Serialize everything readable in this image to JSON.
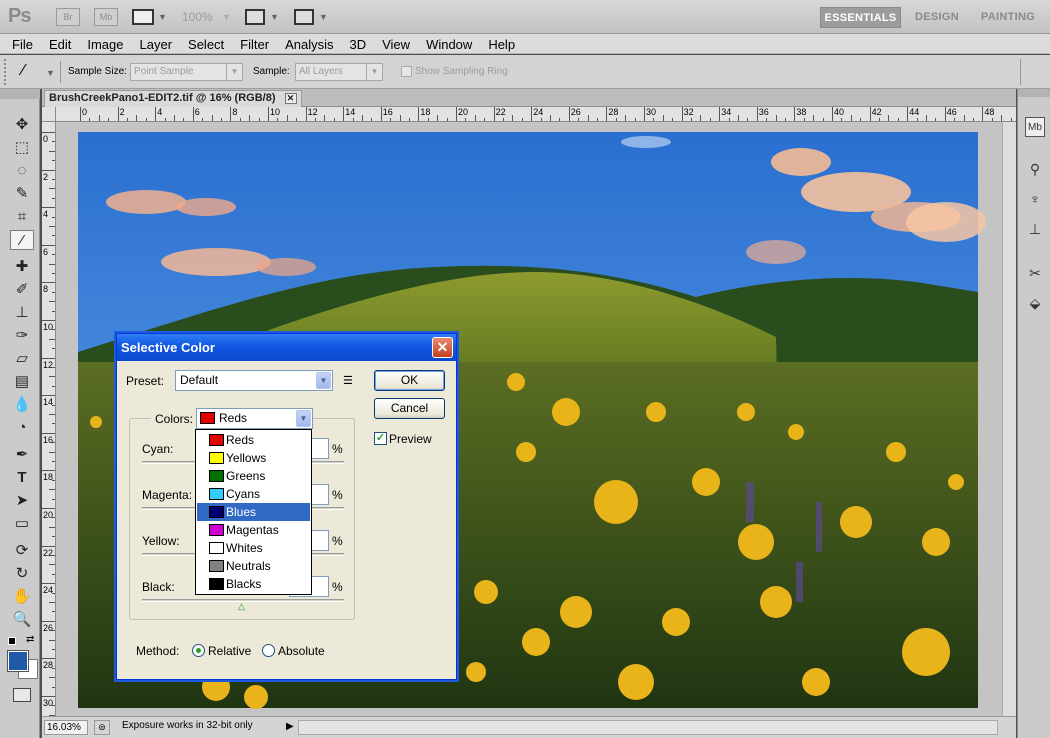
{
  "app": {
    "logo": "Ps",
    "bridge_label": "Br",
    "minibridge_label": "Mb",
    "zoom_level": "100%",
    "workspaces": [
      "ESSENTIALS",
      "DESIGN",
      "PAINTING"
    ]
  },
  "menu": [
    "File",
    "Edit",
    "Image",
    "Layer",
    "Select",
    "Filter",
    "Analysis",
    "3D",
    "View",
    "Window",
    "Help"
  ],
  "options": {
    "sample_size_label": "Sample Size:",
    "sample_size_value": "Point Sample",
    "sample_label": "Sample:",
    "sample_value": "All Layers",
    "show_ring_label": "Show Sampling Ring"
  },
  "document": {
    "tab_title": "BrushCreekPano1-EDIT2.tif @ 16% (RGB/8)",
    "ruler_h": [
      "0",
      "2",
      "4",
      "6",
      "8",
      "10",
      "12",
      "14",
      "16",
      "18",
      "20",
      "22",
      "24",
      "26",
      "28",
      "30",
      "32",
      "34",
      "36",
      "38",
      "40",
      "42",
      "44",
      "46",
      "48"
    ],
    "ruler_v": [
      "0",
      "2",
      "4",
      "6",
      "8",
      "10",
      "12",
      "14",
      "16",
      "18",
      "20",
      "22",
      "24",
      "26",
      "28",
      "30"
    ]
  },
  "status": {
    "zoom": "16.03%",
    "info": "Exposure works in 32-bit only"
  },
  "dialog": {
    "title": "Selective Color",
    "preset_label": "Preset:",
    "preset_value": "Default",
    "ok_label": "OK",
    "cancel_label": "Cancel",
    "preview_label": "Preview",
    "preview_checked": true,
    "colors_label": "Colors:",
    "colors_value": "Reds",
    "sliders": [
      {
        "label": "Cyan:",
        "unit": "%"
      },
      {
        "label": "Magenta:",
        "unit": "%"
      },
      {
        "label": "Yellow:",
        "unit": "%"
      },
      {
        "label": "Black:",
        "unit": "%"
      }
    ],
    "method_label": "Method:",
    "method_options": [
      "Relative",
      "Absolute"
    ],
    "method_selected": "Relative",
    "color_options": [
      {
        "label": "Reds",
        "color": "#e00000"
      },
      {
        "label": "Yellows",
        "color": "#ffff00"
      },
      {
        "label": "Greens",
        "color": "#007000"
      },
      {
        "label": "Cyans",
        "color": "#33ccff"
      },
      {
        "label": "Blues",
        "color": "#000070"
      },
      {
        "label": "Magentas",
        "color": "#d000d0"
      },
      {
        "label": "Whites",
        "color": "#ffffff"
      },
      {
        "label": "Neutrals",
        "color": "#808080"
      },
      {
        "label": "Blacks",
        "color": "#000000"
      }
    ],
    "highlighted_option": "Blues"
  }
}
